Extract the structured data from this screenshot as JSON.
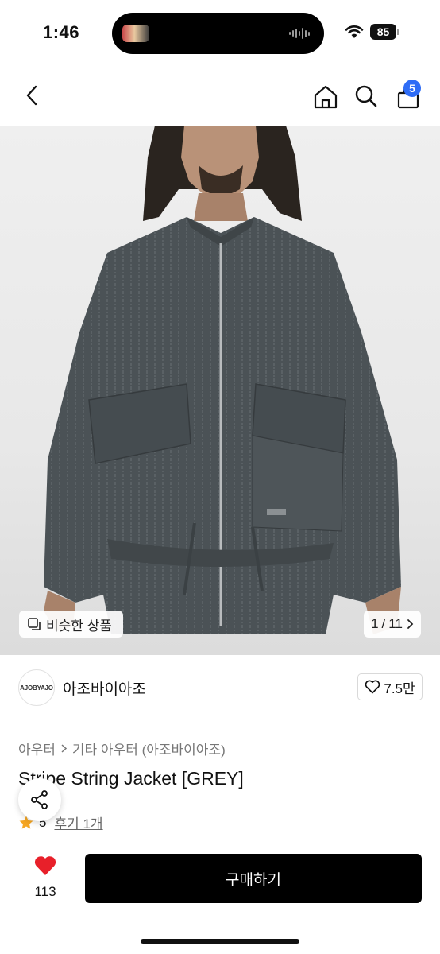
{
  "status_bar": {
    "time": "1:46",
    "battery": "85"
  },
  "nav": {
    "cart_count": "5"
  },
  "product_image": {
    "similar_label": "비슷한 상품",
    "pager_current": "1",
    "pager_sep": "/",
    "pager_total": "11",
    "background_color": "#e9e9e9",
    "garment_color": "#4b5256"
  },
  "brand": {
    "logo_text": "AJOBYAJO",
    "name": "아조바이아조",
    "likes": "7.5만"
  },
  "category": {
    "level1": "아우터",
    "level2": "기타 아우터 (아조바이아조)"
  },
  "product": {
    "title": "Stripe String Jacket [GREY]"
  },
  "rating": {
    "score": "5",
    "review_label": "후기 1개",
    "star_color": "#f5a623"
  },
  "bottom": {
    "wish_count": "113",
    "buy_label": "구매하기",
    "heart_color": "#e8202a"
  }
}
